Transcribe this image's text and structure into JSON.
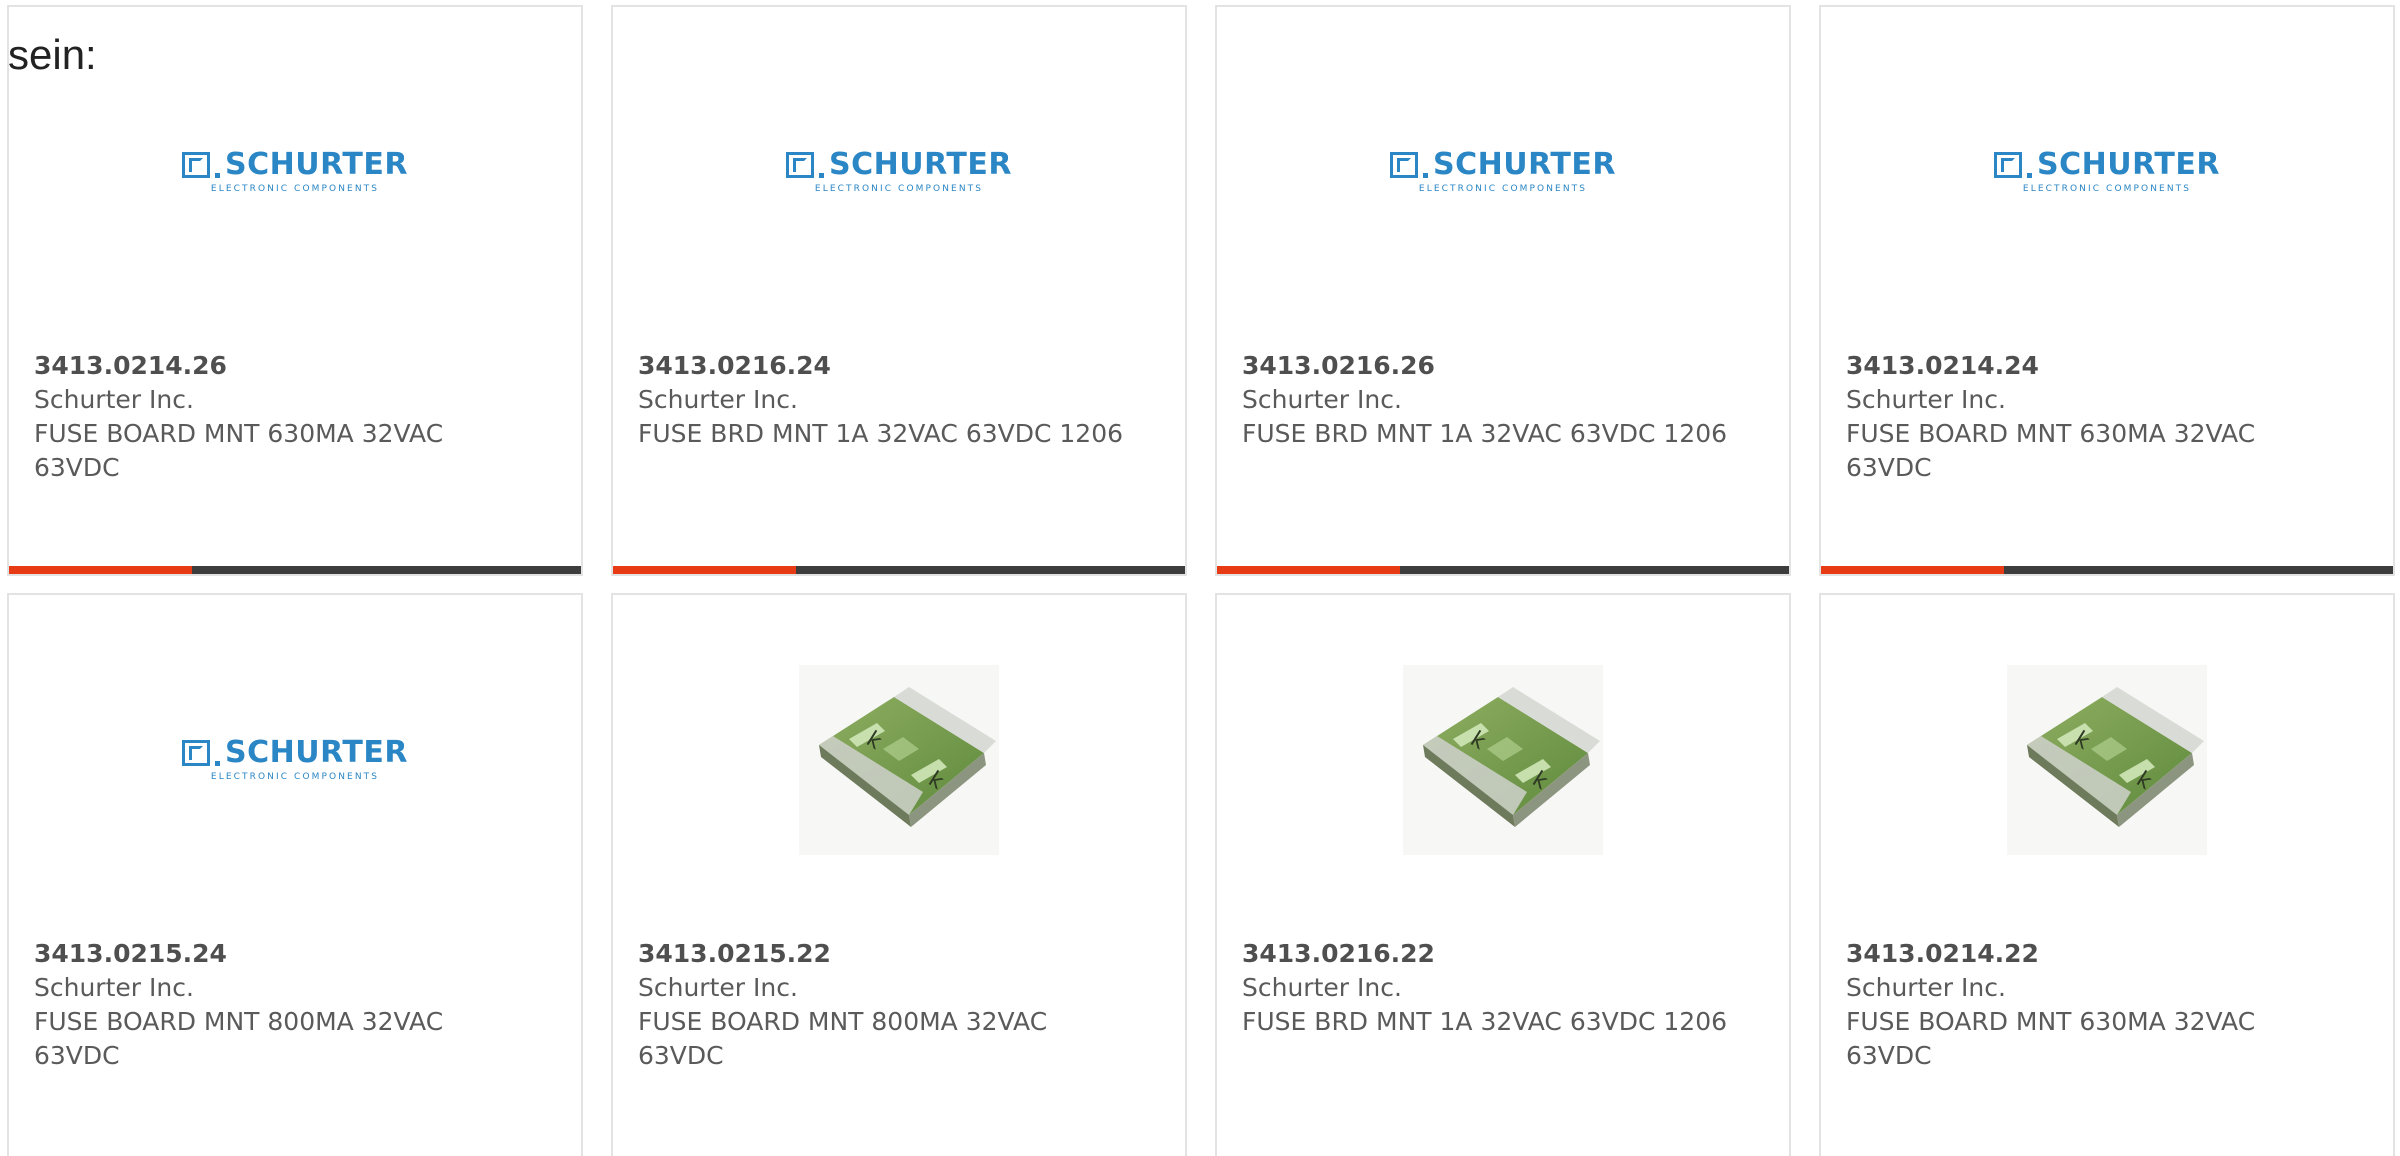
{
  "intro_text": "sein:",
  "brand": {
    "logo_word": "SCHURTER",
    "logo_sub": "ELECTRONIC COMPONENTS",
    "color": "#2a86c4"
  },
  "colors": {
    "accent_bar": "#e63b14",
    "bar_track": "#3d3d3d"
  },
  "products": [
    {
      "part_number": "3413.0214.26",
      "manufacturer": "Schurter Inc.",
      "description": "FUSE BOARD MNT 630MA 32VAC 63VDC",
      "image": "schurter-logo",
      "progress": 0.32
    },
    {
      "part_number": "3413.0216.24",
      "manufacturer": "Schurter Inc.",
      "description": "FUSE BRD MNT 1A 32VAC 63VDC 1206",
      "image": "schurter-logo",
      "progress": 0.32
    },
    {
      "part_number": "3413.0216.26",
      "manufacturer": "Schurter Inc.",
      "description": "FUSE BRD MNT 1A 32VAC 63VDC 1206",
      "image": "schurter-logo",
      "progress": 0.32
    },
    {
      "part_number": "3413.0214.24",
      "manufacturer": "Schurter Inc.",
      "description": "FUSE BOARD MNT 630MA 32VAC 63VDC",
      "image": "schurter-logo",
      "progress": 0.32
    },
    {
      "part_number": "3413.0215.24",
      "manufacturer": "Schurter Inc.",
      "description": "FUSE BOARD MNT 800MA 32VAC 63VDC",
      "image": "schurter-logo"
    },
    {
      "part_number": "3413.0215.22",
      "manufacturer": "Schurter Inc.",
      "description": "FUSE BOARD MNT 800MA 32VAC 63VDC",
      "image": "smd-fuse-photo"
    },
    {
      "part_number": "3413.0216.22",
      "manufacturer": "Schurter Inc.",
      "description": "FUSE BRD MNT 1A 32VAC 63VDC 1206",
      "image": "smd-fuse-photo"
    },
    {
      "part_number": "3413.0214.22",
      "manufacturer": "Schurter Inc.",
      "description": "FUSE BOARD MNT 630MA 32VAC 63VDC",
      "image": "smd-fuse-photo"
    }
  ]
}
